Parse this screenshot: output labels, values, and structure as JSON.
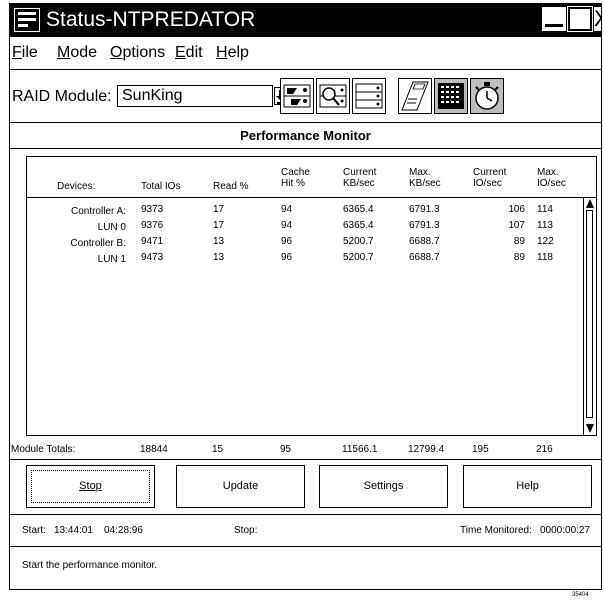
{
  "window": {
    "title": "Status-NTPREDATOR",
    "close_glyph": "X"
  },
  "menu": [
    {
      "label": "File",
      "mnemonic": "F",
      "rest": "ile"
    },
    {
      "label": "Mode",
      "mnemonic": "M",
      "rest": "ode"
    },
    {
      "label": "Options",
      "mnemonic": "O",
      "rest": "ptions"
    },
    {
      "label": "Edit",
      "mnemonic": "E",
      "rest": "dit"
    },
    {
      "label": "Help",
      "mnemonic": "H",
      "rest": "elp"
    }
  ],
  "toolbar": {
    "raid_label": "RAID Module:",
    "raid_value": "SunKing",
    "icons": [
      "configure-icon",
      "search-icon",
      "list-icon",
      "log-icon",
      "status-grid-icon",
      "timer-icon"
    ]
  },
  "panel_title": "Performance Monitor",
  "table": {
    "headers": [
      "Devices:",
      "Total IOs",
      "Read %",
      "Cache\nHit %",
      "Current\nKB/sec",
      "Max.\nKB/sec",
      "Current\nIO/sec",
      "Max.\nIO/sec"
    ],
    "rows": [
      [
        "Controller A:",
        "9373",
        "17",
        "94",
        "6365.4",
        "6791.3",
        "106",
        "114"
      ],
      [
        "LUN 0",
        "9376",
        "17",
        "94",
        "6365.4",
        "6791.3",
        "107",
        "113"
      ],
      [
        "Controller B:",
        "9471",
        "13",
        "96",
        "5200.7",
        "6688.7",
        "89",
        "122"
      ],
      [
        "LUN 1",
        "9473",
        "13",
        "96",
        "5200.7",
        "6688.7",
        "89",
        "118"
      ]
    ]
  },
  "totals": [
    "Module Totals:",
    "18844",
    "15",
    "95",
    "11566.1",
    "12799.4",
    "195",
    "216"
  ],
  "buttons": {
    "stop": "Stop",
    "update": "Update",
    "settings": "Settings",
    "help": "Help"
  },
  "status": {
    "start_label": "Start:",
    "start_time": "13:44:01",
    "start_date": "04:28:96",
    "stop_label": "Stop:",
    "monitored_label": "Time Monitored:",
    "monitored_value": "0000:00:27"
  },
  "hint": "Start the performance monitor.",
  "figure_id": "35404"
}
